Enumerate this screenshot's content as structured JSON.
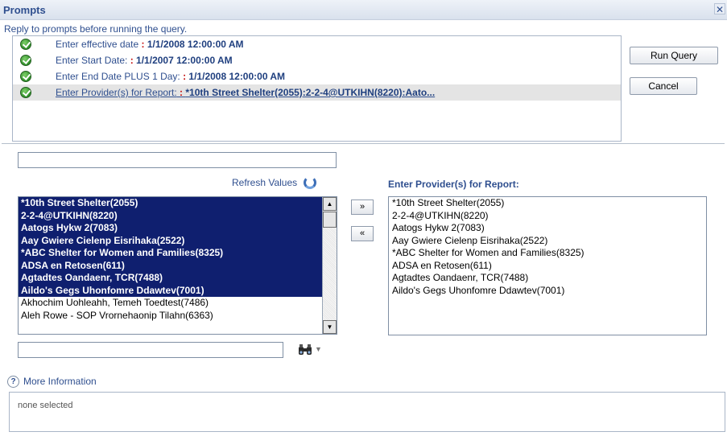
{
  "dialog": {
    "title": "Prompts",
    "close_glyph": "✕",
    "subtitle": "Reply to prompts before running the query."
  },
  "prompts": [
    {
      "label": "Enter effective date",
      "sep": " : ",
      "value": "1/1/2008 12:00:00 AM"
    },
    {
      "label": "Enter Start Date:",
      "sep": " : ",
      "value": "1/1/2007 12:00:00 AM"
    },
    {
      "label": "Enter End Date PLUS 1 Day:",
      "sep": " : ",
      "value": "1/1/2008 12:00:00 AM"
    },
    {
      "label": "Enter Provider(s) for Report:",
      "sep": " : ",
      "value": "*10th Street Shelter(2055):2-2-4@UTKIHN(8220):Aato..."
    }
  ],
  "buttons": {
    "run_query": "Run Query",
    "cancel": "Cancel",
    "add": "»",
    "remove": "«"
  },
  "values_panel": {
    "refresh_label": "Refresh Values",
    "search_value": "",
    "items": [
      "*10th Street Shelter(2055)",
      "2-2-4@UTKIHN(8220)",
      "Aatogs Hykw 2(7083)",
      "Aay Gwiere Cielenp Eisrihaka(2522)",
      "*ABC Shelter for Women and Families(8325)",
      "ADSA en Retosen(611)",
      "Agtadtes Oandaenr, TCR(7488)",
      "Aildo's Gegs Uhonfomre Ddawtev(7001)",
      "Akhochim Uohleahh, Temeh Toedtest(7486)",
      "Aleh Rowe - SOP Vrornehaonip Tilahn(6363)"
    ],
    "scroll_up": "▲",
    "scroll_down": "▼"
  },
  "selected_panel": {
    "title": "Enter Provider(s) for Report:",
    "items": [
      "*10th Street Shelter(2055)",
      "2-2-4@UTKIHN(8220)",
      "Aatogs Hykw 2(7083)",
      "Aay Gwiere Cielenp Eisrihaka(2522)",
      "*ABC Shelter for Women and Families(8325)",
      "ADSA en Retosen(611)",
      "Agtadtes Oandaenr, TCR(7488)",
      "Aildo's Gegs Uhonfomre Ddawtev(7001)"
    ]
  },
  "find": {
    "value": "",
    "caret": "▼"
  },
  "info": {
    "icon_glyph": "?",
    "label": "More Information",
    "text": "none selected"
  }
}
